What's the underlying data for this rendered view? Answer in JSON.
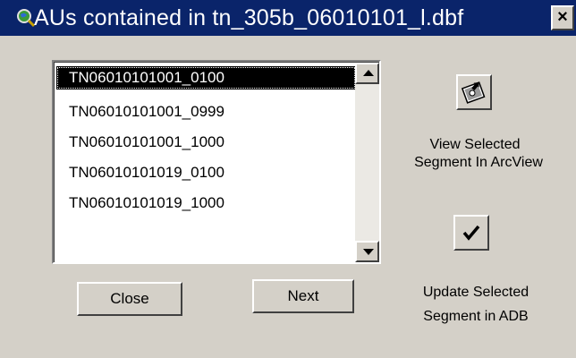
{
  "window": {
    "title": "AUs contained in tn_305b_06010101_l.dbf",
    "close_glyph": "×"
  },
  "list": {
    "items": [
      {
        "label": "TN06010101001_0100",
        "selected": true
      },
      {
        "label": "TN06010101001_0999",
        "selected": false
      },
      {
        "label": "TN06010101001_1000",
        "selected": false
      },
      {
        "label": "TN06010101019_0100",
        "selected": false
      },
      {
        "label": "TN06010101019_1000",
        "selected": false
      }
    ]
  },
  "buttons": {
    "close_label": "Close",
    "next_label": "Next"
  },
  "actions": {
    "view": {
      "line1": "View Selected",
      "line2": "Segment In ArcView",
      "icon": "map-locate-icon"
    },
    "update": {
      "line1": "Update Selected",
      "line2": "Segment in ADB",
      "icon": "checkmark-icon"
    }
  },
  "colors": {
    "titlebar": "#0a246a",
    "window": "#d4d0c8",
    "selection": "#000000"
  }
}
